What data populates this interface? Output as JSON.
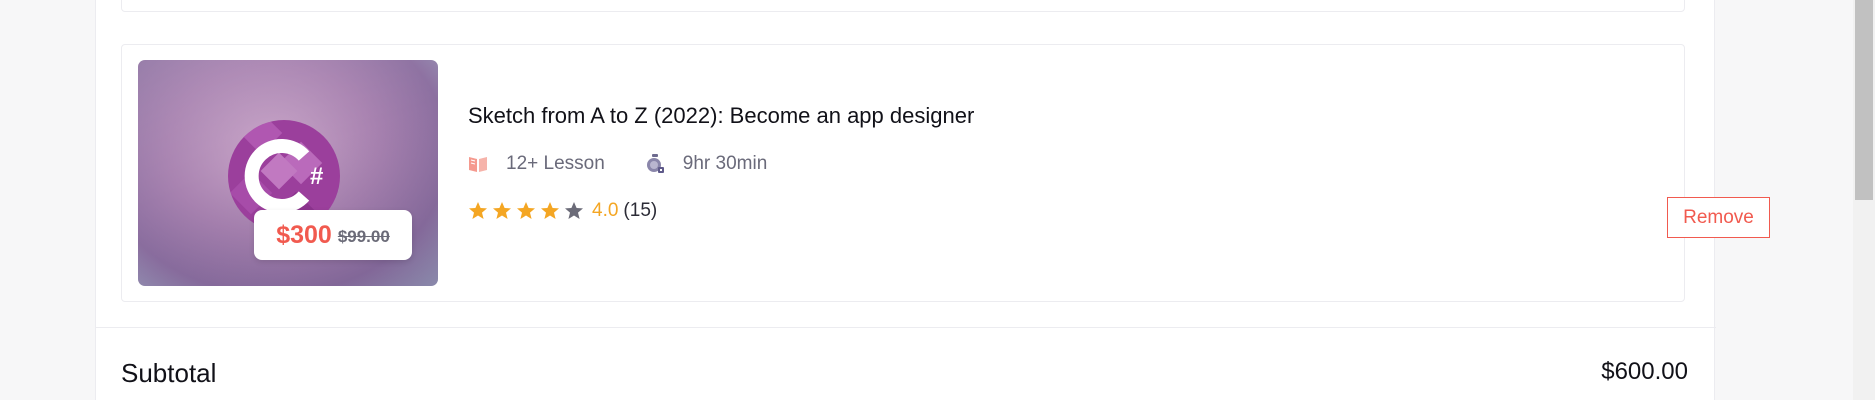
{
  "course": {
    "title": "Sketch from A to Z (2022): Become an app designer",
    "lessons": "12+ Lesson",
    "duration": "9hr 30min",
    "rating_value": "4.0",
    "rating_count": "(15)",
    "stars": 4,
    "stars_total": 5,
    "price": "$300",
    "original_price": "$99.00",
    "thumbnail_icon": "csharp-logo"
  },
  "actions": {
    "remove_label": "Remove"
  },
  "summary": {
    "subtotal_label": "Subtotal",
    "subtotal_value": "$600.00"
  },
  "colors": {
    "accent": "#f15a4f",
    "star": "#f4a623",
    "star_empty": "#6b6b78"
  }
}
